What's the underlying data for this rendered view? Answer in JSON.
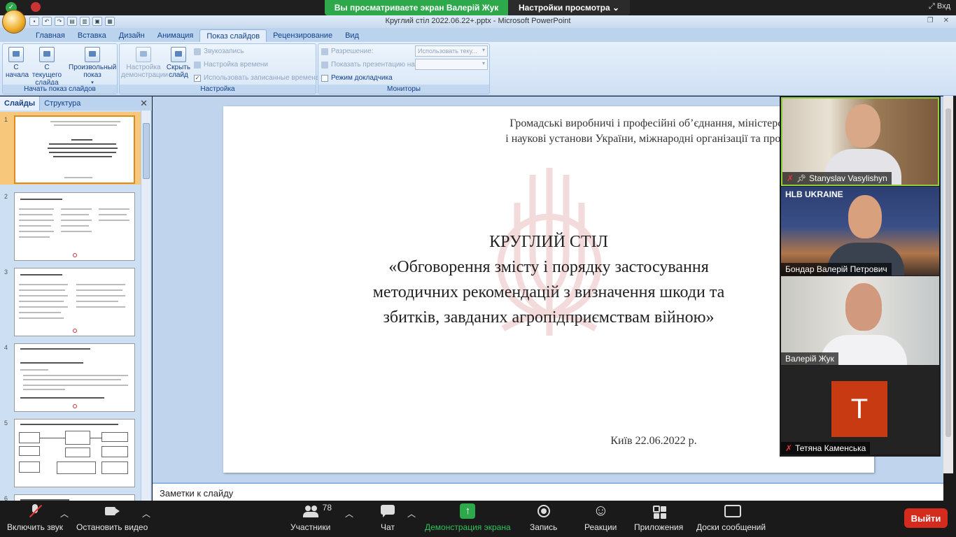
{
  "zoom": {
    "share_banner": "Вы просматриваете экран Валерій Жук",
    "view_options": "Настройки просмотра",
    "exit_fullscreen": "Вхд"
  },
  "window": {
    "title": "Круглий стіл 2022.06.22+.pptx - Microsoft PowerPoint"
  },
  "ribbon": {
    "tabs": [
      "Главная",
      "Вставка",
      "Дизайн",
      "Анимация",
      "Показ слайдов",
      "Рецензирование",
      "Вид"
    ],
    "active_tab": "Показ слайдов",
    "groups": {
      "start": {
        "label": "Начать показ слайдов",
        "from_beginning": "С начала",
        "from_current": "С текущего слайда",
        "custom_show": "Произвольный показ"
      },
      "setup": {
        "label": "Настройка",
        "setup_show": "Настройка демонстрации",
        "hide_slide": "Скрыть слайд",
        "record_narration": "Звукозапись",
        "rehearse": "Настройка времени",
        "use_timings": "Использовать записанные времена"
      },
      "monitors": {
        "label": "Мониторы",
        "resolution_label": "Разрешение:",
        "resolution_value": "Использовать теку...",
        "show_on_label": "Показать презентацию на:",
        "show_on_value": "",
        "presenter_view": "Режим докладчика"
      }
    }
  },
  "left_pane": {
    "tab_slides": "Слайды",
    "tab_outline": "Структура",
    "close": "✕",
    "thumbnails": [
      "1",
      "2",
      "3",
      "4",
      "5",
      "6"
    ],
    "selected": 1
  },
  "slide": {
    "header_line1": "Громадські виробничі і професійні об’єднання, міністерства",
    "header_line2": "і наукові установи України, міжнародні організації та проекти",
    "title_line1": "КРУГЛИЙ СТІЛ",
    "title_line2": "«Обговорення змісту і порядку застосування",
    "title_line3": "методичних рекомендацій з визначення шкоди та",
    "title_line4": "збитків, завданих агропідприємствам війною»",
    "footer": "Київ 22.06.2022 р."
  },
  "notes": {
    "label": "Заметки к слайду"
  },
  "participants": [
    {
      "name": "Stanyslav Vasylishyn",
      "muted": true,
      "pinned": true,
      "speaking": true
    },
    {
      "name": "Бондар Валерій Петрович",
      "muted": false,
      "pinned": false,
      "speaking": false,
      "bg_text": "HLB UKRAINE"
    },
    {
      "name": "Валерій Жук",
      "muted": false,
      "pinned": false,
      "speaking": false
    },
    {
      "name": "Тетяна Каменська",
      "muted": true,
      "pinned": false,
      "speaking": false,
      "avatar_letter": "T",
      "avatar_color": "#c83a12"
    }
  ],
  "toolbar": {
    "unmute": "Включить звук",
    "stop_video": "Остановить видео",
    "participants": "Участники",
    "participants_count": "78",
    "chat": "Чат",
    "share_screen": "Демонстрация экрана",
    "record": "Запись",
    "reactions": "Реакции",
    "apps": "Приложения",
    "whiteboards": "Доски сообщений",
    "leave": "Выйти"
  },
  "colors": {
    "share_green": "#2da84a",
    "leave_red": "#d52b1e",
    "ribbon_blue": "#15428b",
    "selected_thumb": "#f7c87b"
  }
}
